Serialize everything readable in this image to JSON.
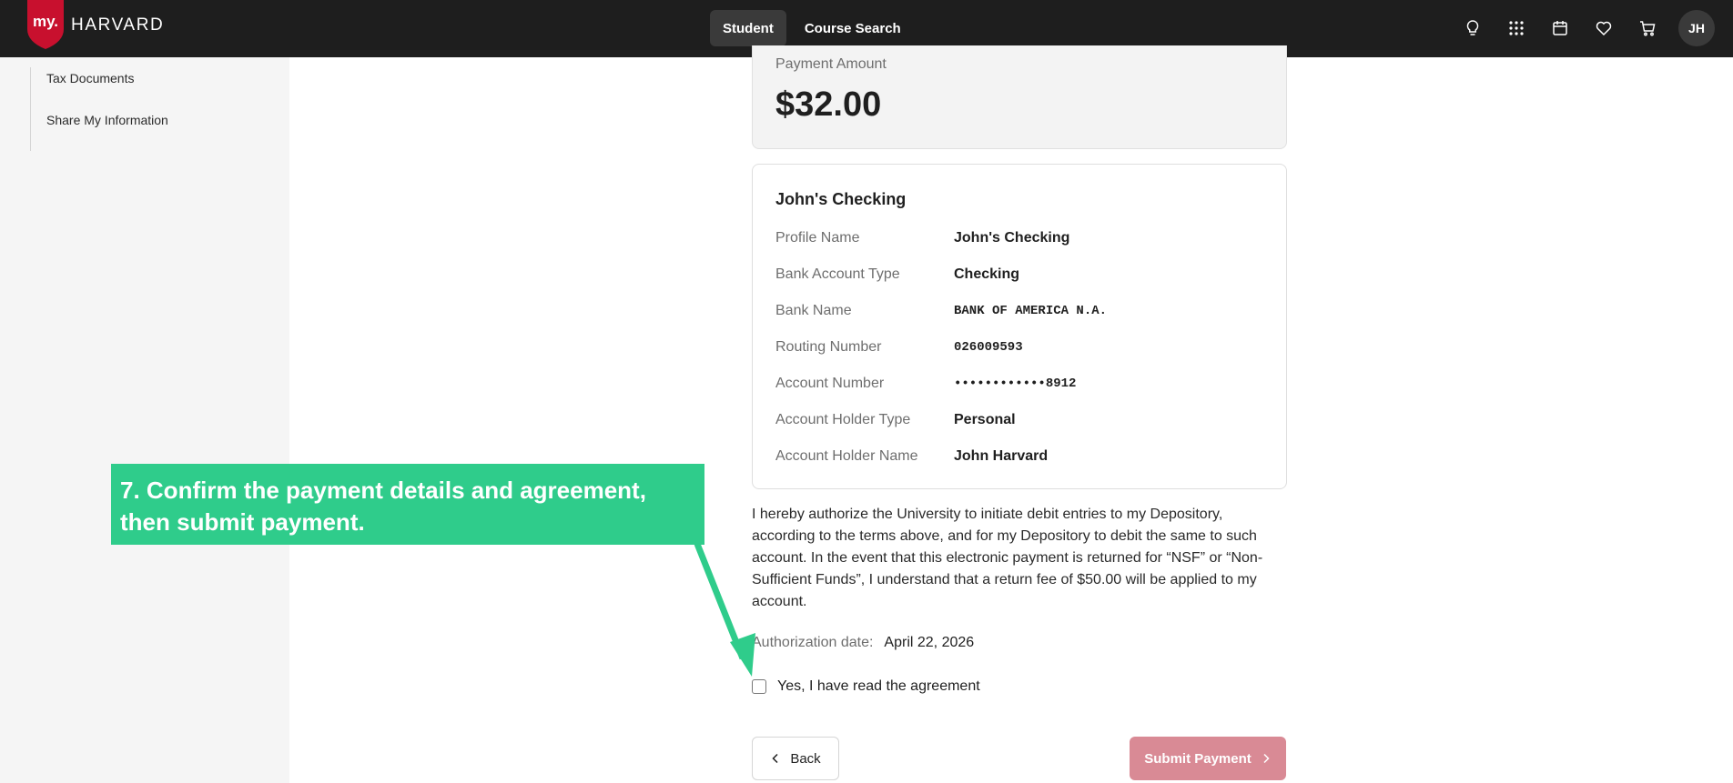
{
  "header": {
    "logo": {
      "prefix": "my.",
      "word": "HARVARD"
    },
    "tabs": [
      {
        "label": "Student",
        "active": true
      },
      {
        "label": "Course Search",
        "active": false
      }
    ],
    "icons": [
      "lightbulb-icon",
      "apps-grid-icon",
      "calendar-icon",
      "heart-icon",
      "cart-icon"
    ],
    "avatar_initials": "JH"
  },
  "sidebar": {
    "items": [
      {
        "label": "Tax Documents"
      },
      {
        "label": "Share My Information"
      }
    ]
  },
  "payment": {
    "amount_label": "Payment Amount",
    "amount_value": "$32.00"
  },
  "account": {
    "title": "John's Checking",
    "rows": [
      {
        "key": "Profile Name",
        "value": "John's Checking"
      },
      {
        "key": "Bank Account Type",
        "value": "Checking"
      },
      {
        "key": "Bank Name",
        "value": "BANK OF AMERICA N.A."
      },
      {
        "key": "Routing Number",
        "value": "026009593"
      },
      {
        "key": "Account Number",
        "value": "••••••••••••8912"
      },
      {
        "key": "Account Holder Type",
        "value": "Personal"
      },
      {
        "key": "Account Holder Name",
        "value": "John Harvard"
      }
    ]
  },
  "agreement": {
    "text": "I hereby authorize the University to initiate debit entries to my Depository, according to the terms above, and for my Depository to debit the same to such account. In the event that this electronic payment is returned for “NSF” or “Non-Sufficient Funds”, I understand that a return fee of $50.00 will be applied to my account.",
    "auth_label": "Authorization date:",
    "auth_date": "April 22, 2026",
    "checkbox_label": "Yes, I have read the agreement",
    "checked": false
  },
  "actions": {
    "back_label": "Back",
    "submit_label": "Submit Payment"
  },
  "annotation": {
    "text": "7. Confirm the payment details and agreement, then submit payment."
  },
  "colors": {
    "topbar": "#1e1e1e",
    "crimson": "#c8102e",
    "submit": "#d98a95",
    "callout": "#2fcc8b"
  }
}
